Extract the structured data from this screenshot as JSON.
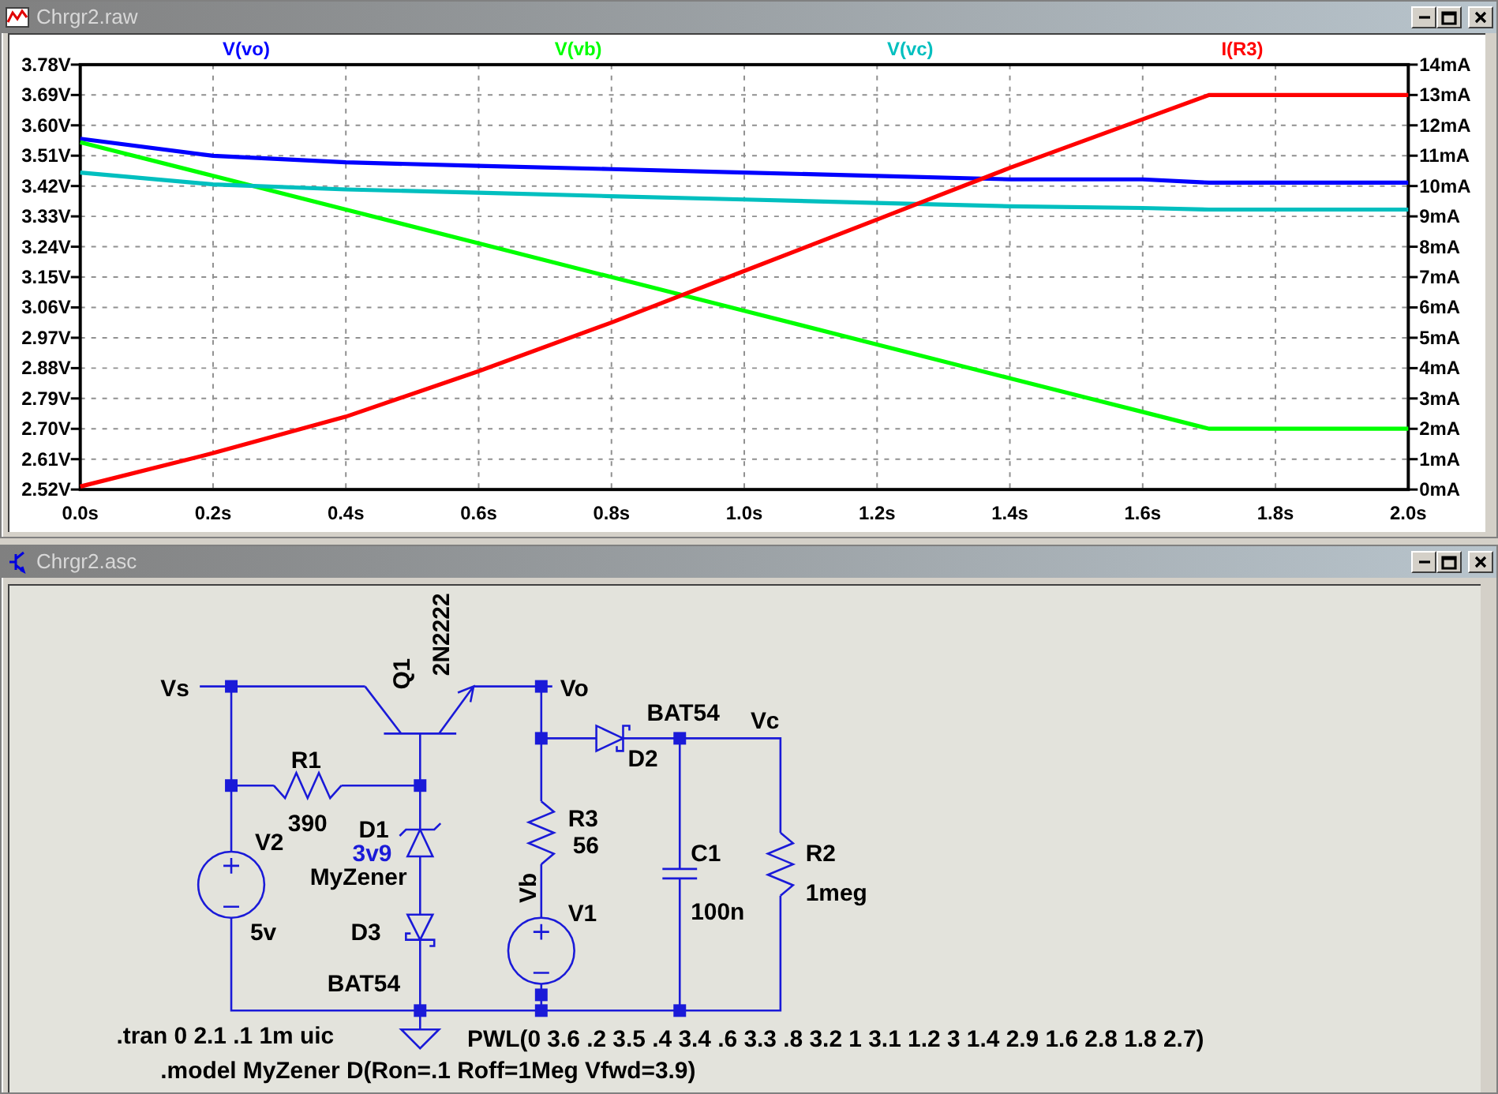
{
  "plot_window": {
    "title": "Chrgr2.raw",
    "chart_data": {
      "type": "line",
      "x": [
        0,
        0.2,
        0.4,
        0.6,
        0.8,
        1.0,
        1.2,
        1.4,
        1.6,
        1.7,
        1.8,
        2.0
      ],
      "series": [
        {
          "name": "V(vo)",
          "color": "#0000ff",
          "values": [
            3.56,
            3.51,
            3.49,
            3.48,
            3.47,
            3.46,
            3.45,
            3.44,
            3.44,
            3.43,
            3.43,
            3.43
          ]
        },
        {
          "name": "V(vb)",
          "color": "#00ff00",
          "values": [
            3.55,
            3.45,
            3.35,
            3.25,
            3.15,
            3.05,
            2.95,
            2.85,
            2.75,
            2.7,
            2.7,
            2.7
          ]
        },
        {
          "name": "V(vc)",
          "color": "#00bfbf",
          "values": [
            3.46,
            3.425,
            3.41,
            3.4,
            3.39,
            3.38,
            3.37,
            3.36,
            3.355,
            3.35,
            3.35,
            3.35
          ]
        },
        {
          "name": "I(R3)",
          "color": "#ff0000",
          "axis": "y2",
          "values": [
            0.1,
            1.2,
            2.4,
            3.9,
            5.5,
            7.2,
            8.9,
            10.6,
            12.2,
            13.0,
            13.0,
            13.0
          ]
        }
      ],
      "grid": true,
      "xlim": [
        0,
        2.0
      ],
      "ylim": [
        2.52,
        3.78
      ],
      "y2lim": [
        0,
        14
      ],
      "xticks": [
        {
          "value": 0,
          "label": "0.0s"
        },
        {
          "value": 0.2,
          "label": "0.2s"
        },
        {
          "value": 0.4,
          "label": "0.4s"
        },
        {
          "value": 0.6,
          "label": "0.6s"
        },
        {
          "value": 0.8,
          "label": "0.8s"
        },
        {
          "value": 1.0,
          "label": "1.0s"
        },
        {
          "value": 1.2,
          "label": "1.2s"
        },
        {
          "value": 1.4,
          "label": "1.4s"
        },
        {
          "value": 1.6,
          "label": "1.6s"
        },
        {
          "value": 1.8,
          "label": "1.8s"
        },
        {
          "value": 2.0,
          "label": "2.0s"
        }
      ],
      "yticks": [
        {
          "value": 3.78,
          "label": "3.78V"
        },
        {
          "value": 3.69,
          "label": "3.69V"
        },
        {
          "value": 3.6,
          "label": "3.60V"
        },
        {
          "value": 3.51,
          "label": "3.51V"
        },
        {
          "value": 3.42,
          "label": "3.42V"
        },
        {
          "value": 3.33,
          "label": "3.33V"
        },
        {
          "value": 3.24,
          "label": "3.24V"
        },
        {
          "value": 3.15,
          "label": "3.15V"
        },
        {
          "value": 3.06,
          "label": "3.06V"
        },
        {
          "value": 2.97,
          "label": "2.97V"
        },
        {
          "value": 2.88,
          "label": "2.88V"
        },
        {
          "value": 2.79,
          "label": "2.79V"
        },
        {
          "value": 2.7,
          "label": "2.70V"
        },
        {
          "value": 2.61,
          "label": "2.61V"
        },
        {
          "value": 2.52,
          "label": "2.52V"
        }
      ],
      "y2ticks": [
        {
          "value": 14,
          "label": "14mA"
        },
        {
          "value": 13,
          "label": "13mA"
        },
        {
          "value": 12,
          "label": "12mA"
        },
        {
          "value": 11,
          "label": "11mA"
        },
        {
          "value": 10,
          "label": "10mA"
        },
        {
          "value": 9,
          "label": "9mA"
        },
        {
          "value": 8,
          "label": "8mA"
        },
        {
          "value": 7,
          "label": "7mA"
        },
        {
          "value": 6,
          "label": "6mA"
        },
        {
          "value": 5,
          "label": "5mA"
        },
        {
          "value": 4,
          "label": "4mA"
        },
        {
          "value": 3,
          "label": "3mA"
        },
        {
          "value": 2,
          "label": "2mA"
        },
        {
          "value": 1,
          "label": "1mA"
        },
        {
          "value": 0,
          "label": "0mA"
        }
      ]
    }
  },
  "schematic_window": {
    "title": "Chrgr2.asc",
    "net_labels": [
      "Vs",
      "Vo",
      "Vc",
      "Vb"
    ],
    "components": [
      {
        "kind": "transistor",
        "ref": "Q1",
        "value": "2N2222"
      },
      {
        "kind": "resistor",
        "ref": "R1",
        "value": "390"
      },
      {
        "kind": "zener",
        "ref": "D1",
        "attribute": "3v9",
        "value": "MyZener"
      },
      {
        "kind": "source",
        "ref": "V2",
        "value": "5v"
      },
      {
        "kind": "schottky",
        "ref": "D3",
        "value": "BAT54"
      },
      {
        "kind": "resistor",
        "ref": "R3",
        "value": "56"
      },
      {
        "kind": "source",
        "ref": "V1",
        "value": "PWL(0 3.6 .2 3.5 .4 3.4 .6 3.3 .8 3.2 1 3.1 1.2 3 1.4 2.9 1.6 2.8 1.8 2.7)"
      },
      {
        "kind": "schottky",
        "ref": "D2",
        "value": "BAT54"
      },
      {
        "kind": "capacitor",
        "ref": "C1",
        "value": "100n"
      },
      {
        "kind": "resistor",
        "ref": "R2",
        "value": "1meg"
      }
    ],
    "directives": [
      ".tran 0 2.1 .1 1m uic",
      ".model MyZener D(Ron=.1 Roff=1Meg Vfwd=3.9)"
    ]
  }
}
